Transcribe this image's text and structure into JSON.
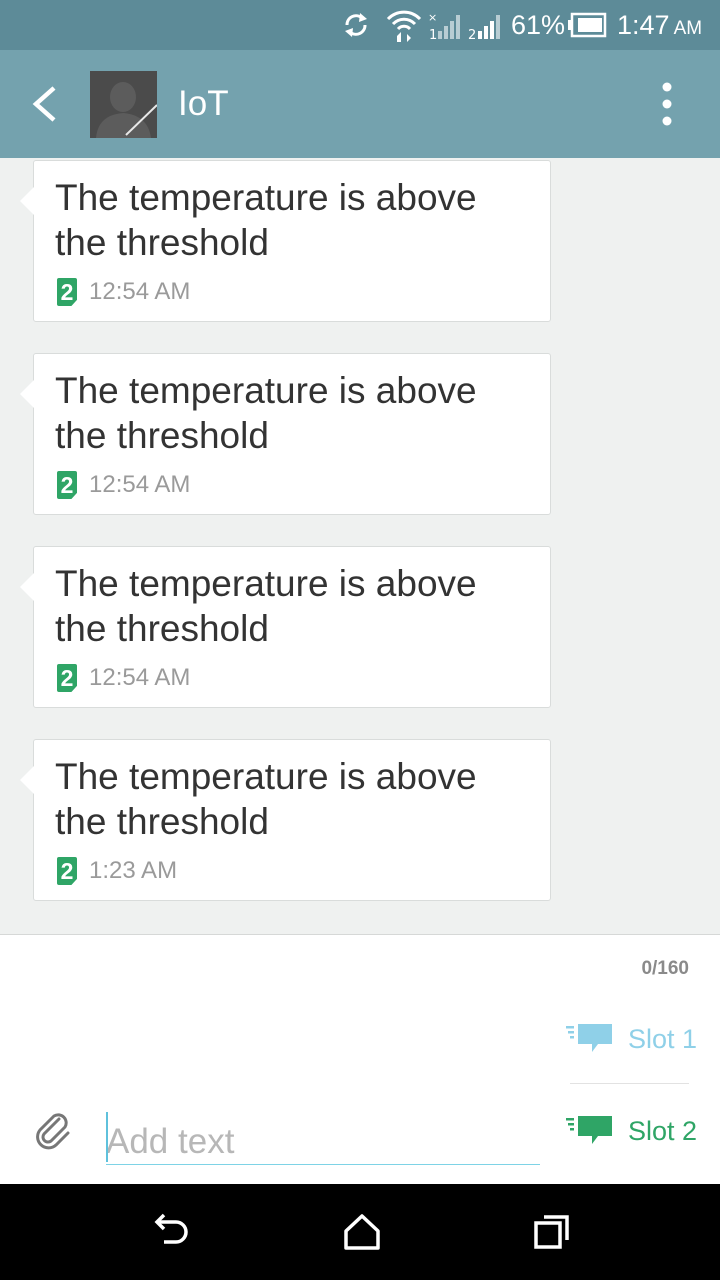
{
  "status_bar": {
    "battery_percent": "61%",
    "time": "1:47",
    "time_suffix": "AM",
    "sim1_label": "1",
    "sim2_label": "2",
    "icons": [
      "sync-icon",
      "wifi-icon",
      "signal-sim1-icon",
      "signal-sim2-icon",
      "battery-icon"
    ]
  },
  "app_bar": {
    "title": "IoT",
    "icons": [
      "back-arrow-icon",
      "contact-avatar",
      "overflow-menu-icon"
    ]
  },
  "messages": [
    {
      "text": "The temperature is above the threshold",
      "sim": "2",
      "time": "12:54 AM"
    },
    {
      "text": "The temperature is above the threshold",
      "sim": "2",
      "time": "12:54 AM"
    },
    {
      "text": "The temperature is above the threshold",
      "sim": "2",
      "time": "12:54 AM"
    },
    {
      "text": "The temperature is above the threshold",
      "sim": "2",
      "time": "1:23 AM"
    }
  ],
  "compose": {
    "char_count": "0/160",
    "placeholder": "Add text",
    "value": "",
    "slot1_label": "Slot 1",
    "slot2_label": "Slot 2",
    "slot1_color": "#8fd0e8",
    "slot2_color": "#2fa566"
  },
  "colors": {
    "status_bar": "#5d8b98",
    "app_bar": "#74a2ae",
    "sim_badge": "#2fa566",
    "background": "#eff1f0"
  }
}
